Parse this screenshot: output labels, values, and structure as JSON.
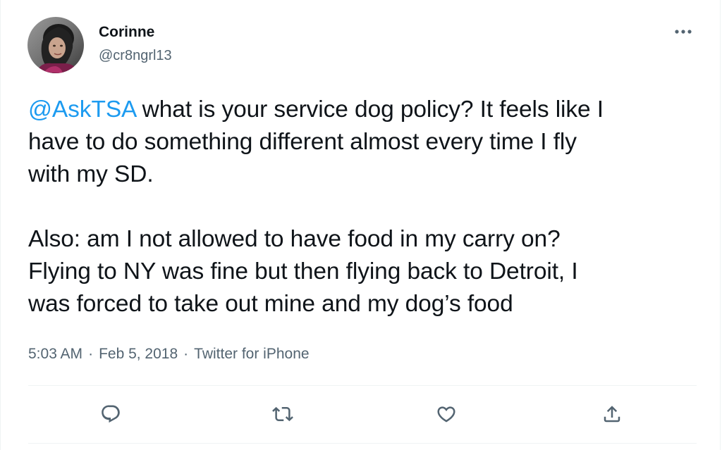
{
  "author": {
    "display_name": "Corinne",
    "handle": "@cr8ngrl13",
    "avatar_icon": "user-avatar"
  },
  "tweet": {
    "mention": "@AskTSA",
    "paragraph1_rest": " what is your service dog policy? It feels like I\nhave to do something different almost every time I fly\nwith my SD.",
    "paragraph2": "Also: am I not allowed to have food in my carry on?\nFlying to NY was fine but then flying back to Detroit, I\nwas forced to take out mine and my dog’s food"
  },
  "meta": {
    "time": "5:03 AM",
    "separator": "·",
    "date": "Feb 5, 2018",
    "source": "Twitter for iPhone"
  },
  "actions": [
    {
      "name": "reply",
      "icon": "reply-icon"
    },
    {
      "name": "retweet",
      "icon": "retweet-icon"
    },
    {
      "name": "like",
      "icon": "heart-icon"
    },
    {
      "name": "share",
      "icon": "share-icon"
    }
  ],
  "colors": {
    "text": "#0f1419",
    "secondary": "#536471",
    "link": "#1d9bf0",
    "divider": "#eff3f4"
  }
}
